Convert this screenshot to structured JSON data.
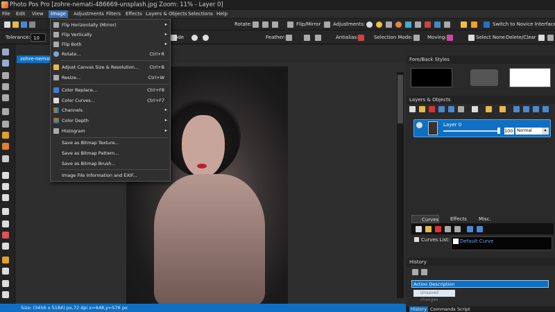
{
  "window": {
    "title": "Photo Pos Pro [zohre-nemati-486669-unsplash.jpg Zoom: 11% - Layer 0]"
  },
  "menu": [
    "File",
    "Edit",
    "View",
    "Image",
    "Adjustments",
    "Filters",
    "Effects",
    "Layers & Objects",
    "Selections",
    "Help"
  ],
  "toolbar1": {
    "rotate_label": "Rotate:",
    "flipmirror_label": "Flip/Mirror",
    "adjustments_label": "Adjustments:",
    "novice_label": "Switch to Novice Interface"
  },
  "toolbar2": {
    "tolerance_label": "Tolerance:",
    "tolerance_value": "10",
    "mode_label": "Mode",
    "feather_label": "Feather:",
    "antialias_label": "Antialias:",
    "selection_mode_label": "Selection Mode:",
    "moving_label": "Moving:",
    "select_none": "Select None",
    "delete_clear": "Delete/Clear"
  },
  "document_tab": "zohre-nemati",
  "status": "Size: (3456 x 5184) px,72 dpi   x=648,y=576 px",
  "image_menu": [
    {
      "label": "Flip Horizontally (Mirror)",
      "shortcut": "",
      "arrow": "▸",
      "icon": "flip-horizontal-icon"
    },
    {
      "label": "Flip Vertically",
      "shortcut": "",
      "arrow": "▸",
      "icon": "flip-vertical-icon"
    },
    {
      "label": "Flip Both",
      "shortcut": "",
      "arrow": "▸",
      "icon": "flip-both-icon"
    },
    {
      "label": "Rotate...",
      "shortcut": "Ctrl+R",
      "arrow": "",
      "icon": "rotate-icon"
    },
    {
      "label": "Adjust Canvas Size & Resolution...",
      "shortcut": "Ctrl+B",
      "arrow": "",
      "icon": "canvas-size-icon"
    },
    {
      "label": "Resize...",
      "shortcut": "Ctrl+W",
      "arrow": "",
      "icon": "resize-icon"
    },
    {
      "label": "Color Replace...",
      "shortcut": "Ctrl+F8",
      "arrow": "",
      "icon": "color-replace-icon"
    },
    {
      "label": "Color Curves...",
      "shortcut": "Ctrl+F7",
      "arrow": "",
      "icon": "color-curves-icon"
    },
    {
      "label": "Channels",
      "shortcut": "",
      "arrow": "▸",
      "icon": "channels-icon"
    },
    {
      "label": "Color Depth",
      "shortcut": "",
      "arrow": "▸",
      "icon": "color-depth-icon"
    },
    {
      "label": "Histogram",
      "shortcut": "",
      "arrow": "▸",
      "icon": "histogram-icon"
    },
    {
      "label": "Save as Bitmap Texture...",
      "shortcut": "",
      "arrow": "",
      "icon": ""
    },
    {
      "label": "Save as Bitmap Pattern...",
      "shortcut": "",
      "arrow": "",
      "icon": ""
    },
    {
      "label": "Save as Bitmap Brush...",
      "shortcut": "",
      "arrow": "",
      "icon": ""
    },
    {
      "label": "Image File Information and EXIF...",
      "shortcut": "",
      "arrow": "",
      "icon": ""
    }
  ],
  "panels": {
    "foreback_title": "Fore/Back Styles",
    "layers_title": "Layers & Objects",
    "layer_name": "Layer 0",
    "layer_opacity": "100",
    "layer_blend": "Normal",
    "tabs": [
      "Curves",
      "Effects",
      "Misc."
    ],
    "curves_list_label": "Curves List:",
    "curves_list_value": "Default Curve",
    "history_title": "History",
    "history_item": "Action Description",
    "history_item2": "Unsaved changes",
    "bottom_tabs": [
      "History",
      "Commands Script"
    ]
  },
  "colors": {
    "accent": "#0f6fc2",
    "background": "#2b2b2b",
    "menu_bg": "#2f2f2f"
  }
}
